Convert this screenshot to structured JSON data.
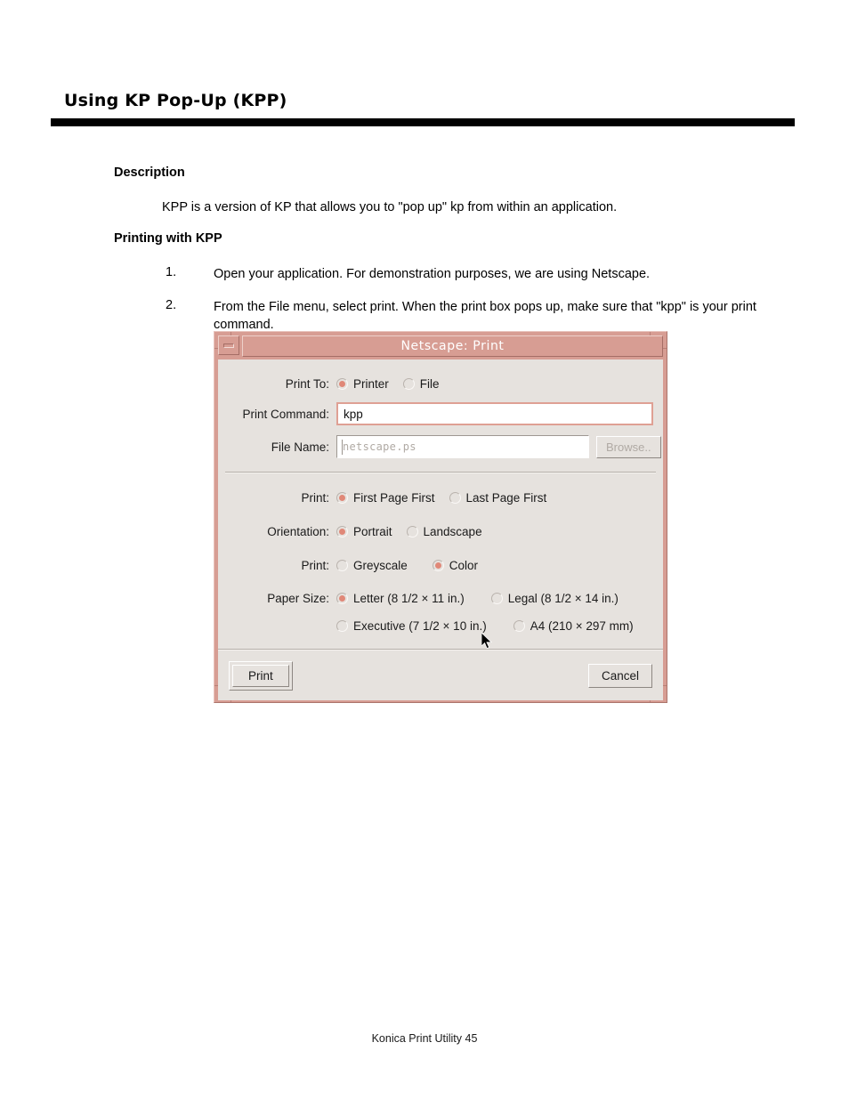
{
  "document": {
    "title": "Using KP Pop-Up (KPP)",
    "sections": {
      "description_head": "Description",
      "description_body": "KPP is a version of KP that allows you to \"pop up\" kp from within an application.",
      "printing_head": "Printing with KPP"
    },
    "steps": [
      {
        "number": "1.",
        "text": "Open your application. For demonstration purposes, we are using Netscape."
      },
      {
        "number": "2.",
        "text": "From the File menu, select print. When the print box pops up, make sure that \"kpp\" is your print command."
      }
    ],
    "footer": "Konica Print Utility 45"
  },
  "dialog": {
    "title": "Netscape: Print",
    "minimize_icon": "minimize-icon",
    "colors": {
      "titlebar": "#d79d93",
      "frame": "#d79d93",
      "client": "#e6e2de",
      "radio_selected": "#e08878",
      "focus_border": "#dfa094"
    },
    "print_to": {
      "label": "Print To:",
      "options": [
        {
          "label": "Printer",
          "selected": true
        },
        {
          "label": "File",
          "selected": false
        }
      ]
    },
    "print_command": {
      "label": "Print Command:",
      "value": "kpp"
    },
    "file_name": {
      "label": "File Name:",
      "value": "netscape.ps",
      "disabled": true,
      "browse_label": "Browse.."
    },
    "page_order": {
      "label": "Print:",
      "options": [
        {
          "label": "First Page First",
          "selected": true
        },
        {
          "label": "Last Page First",
          "selected": false
        }
      ]
    },
    "orientation": {
      "label": "Orientation:",
      "options": [
        {
          "label": "Portrait",
          "selected": true
        },
        {
          "label": "Landscape",
          "selected": false
        }
      ]
    },
    "color_mode": {
      "label": "Print:",
      "options": [
        {
          "label": "Greyscale",
          "selected": false
        },
        {
          "label": "Color",
          "selected": true
        }
      ]
    },
    "paper_size": {
      "label": "Paper Size:",
      "row1": [
        {
          "label": "Letter (8 1/2 × 11 in.)",
          "selected": true
        },
        {
          "label": "Legal (8 1/2 × 14 in.)",
          "selected": false
        }
      ],
      "row2": [
        {
          "label": "Executive (7 1/2 × 10 in.)",
          "selected": false
        },
        {
          "label": "A4 (210 × 297 mm)",
          "selected": false
        }
      ]
    },
    "buttons": {
      "print": "Print",
      "cancel": "Cancel"
    }
  }
}
